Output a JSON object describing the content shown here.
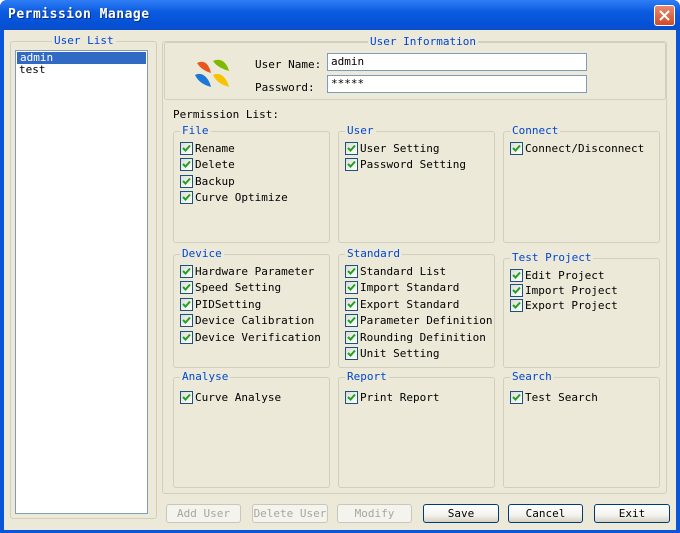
{
  "window": {
    "title": "Permission Manage"
  },
  "user_list": {
    "title": "User List",
    "users": [
      {
        "name": "admin",
        "selected": true
      },
      {
        "name": "test",
        "selected": false
      }
    ]
  },
  "user_info": {
    "title": "User Information",
    "username_label": "User Name:",
    "username_value": "admin",
    "password_label": "Password:",
    "password_value": "*****"
  },
  "permissions": {
    "title": "Permission List:",
    "groups": {
      "file": {
        "title": "File",
        "items": [
          {
            "label": "Rename",
            "checked": true
          },
          {
            "label": "Delete",
            "checked": true
          },
          {
            "label": "Backup",
            "checked": true
          },
          {
            "label": "Curve Optimize",
            "checked": true
          }
        ]
      },
      "user": {
        "title": "User",
        "items": [
          {
            "label": "User Setting",
            "checked": true
          },
          {
            "label": "Password Setting",
            "checked": true
          }
        ]
      },
      "connect": {
        "title": "Connect",
        "items": [
          {
            "label": "Connect/Disconnect",
            "checked": true
          }
        ]
      },
      "device": {
        "title": "Device",
        "items": [
          {
            "label": "Hardware Parameter",
            "checked": true
          },
          {
            "label": "Speed Setting",
            "checked": true
          },
          {
            "label": "PIDSetting",
            "checked": true
          },
          {
            "label": "Device Calibration",
            "checked": true
          },
          {
            "label": "Device Verification",
            "checked": true
          }
        ]
      },
      "standard": {
        "title": "Standard",
        "items": [
          {
            "label": "Standard List",
            "checked": true
          },
          {
            "label": "Import Standard",
            "checked": true
          },
          {
            "label": "Export Standard",
            "checked": true
          },
          {
            "label": "Parameter Definition",
            "checked": true
          },
          {
            "label": "Rounding Definition",
            "checked": true
          },
          {
            "label": "Unit Setting",
            "checked": true
          }
        ]
      },
      "test_project": {
        "title": "Test Project",
        "items": [
          {
            "label": "Edit Project",
            "checked": true
          },
          {
            "label": "Import Project",
            "checked": true
          },
          {
            "label": "Export Project",
            "checked": true
          }
        ]
      },
      "analyse": {
        "title": "Analyse",
        "items": [
          {
            "label": "Curve Analyse",
            "checked": true
          }
        ]
      },
      "report": {
        "title": "Report",
        "items": [
          {
            "label": "Print Report",
            "checked": true
          }
        ]
      },
      "search": {
        "title": "Search",
        "items": [
          {
            "label": "Test Search",
            "checked": true
          }
        ]
      }
    }
  },
  "buttons": {
    "add_user": "Add User",
    "delete_user": "Delete User",
    "modify": "Modify",
    "save": "Save",
    "cancel": "Cancel",
    "exit": "Exit"
  },
  "colors": {
    "titlebar": "#0a5be0",
    "group_title": "#0046d5",
    "selection": "#316ac5",
    "dialog_bg": "#ece9d8"
  }
}
